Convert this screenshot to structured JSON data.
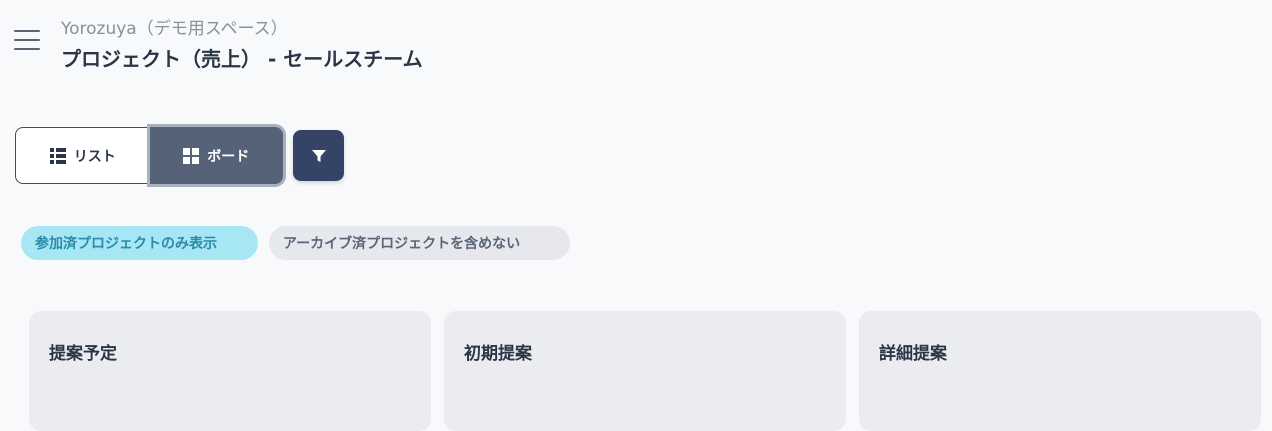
{
  "header": {
    "workspace": "Yorozuya（デモ用スペース）",
    "title": "プロジェクト（売上） - セールスチーム"
  },
  "view_toggle": {
    "list_label": "リスト",
    "board_label": "ボード",
    "selected": "board"
  },
  "filters": {
    "chips": [
      {
        "label": "参加済プロジェクトのみ表示",
        "active": true
      },
      {
        "label": "アーカイブ済プロジェクトを含めない",
        "active": false
      }
    ]
  },
  "board": {
    "columns": [
      {
        "title": "提案予定"
      },
      {
        "title": "初期提案"
      },
      {
        "title": "詳細提案"
      }
    ]
  },
  "icons": [
    "menu-icon",
    "list-icon",
    "grid-icon",
    "filter-icon"
  ],
  "colors": {
    "accent": "#354466",
    "active_chip_bg": "#a6e6f5",
    "active_chip_text": "#2b8aa8"
  }
}
